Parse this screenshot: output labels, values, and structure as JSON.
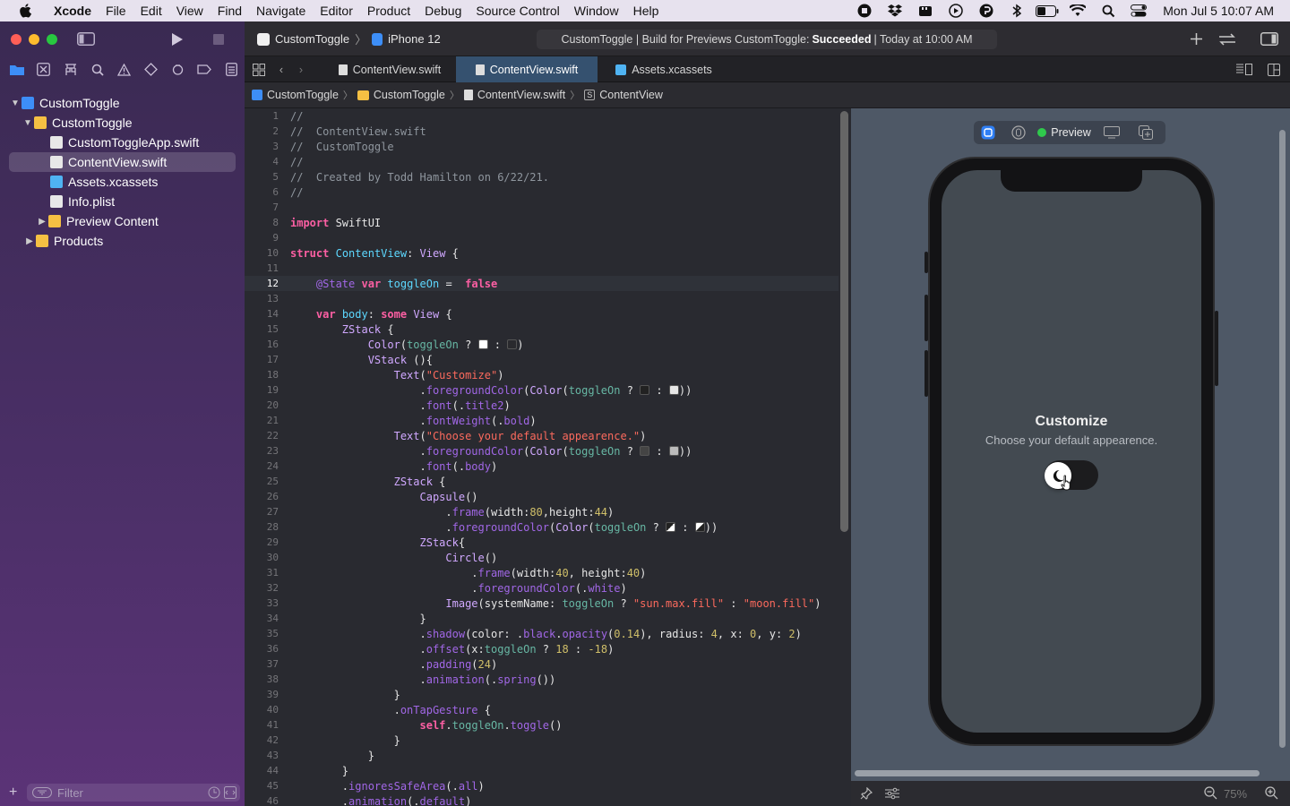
{
  "menubar": {
    "app_name": "Xcode",
    "items": [
      "File",
      "Edit",
      "View",
      "Find",
      "Navigate",
      "Editor",
      "Product",
      "Debug",
      "Source Control",
      "Window",
      "Help"
    ],
    "datetime": "Mon Jul 5  10:07 AM"
  },
  "toolbar": {
    "scheme_project": "CustomToggle",
    "scheme_device": "iPhone 12",
    "status_prefix": "CustomToggle | Build for Previews CustomToggle: ",
    "status_result": "Succeeded",
    "status_suffix": " | Today at 10:00 AM"
  },
  "tabs": [
    {
      "label": "ContentView.swift",
      "active": false
    },
    {
      "label": "ContentView.swift",
      "active": true
    },
    {
      "label": "Assets.xcassets",
      "active": false
    }
  ],
  "jumpbar": [
    "CustomToggle",
    "CustomToggle",
    "ContentView.swift",
    "ContentView"
  ],
  "navigator": {
    "tree": [
      {
        "label": "CustomToggle",
        "level": 0,
        "icon": "project-icon",
        "disclosure": "open"
      },
      {
        "label": "CustomToggle",
        "level": 1,
        "icon": "folder-icon",
        "disclosure": "open"
      },
      {
        "label": "CustomToggleApp.swift",
        "level": 2,
        "icon": "swift-file-icon",
        "disclosure": ""
      },
      {
        "label": "ContentView.swift",
        "level": 2,
        "icon": "swift-file-icon",
        "disclosure": "",
        "selected": true
      },
      {
        "label": "Assets.xcassets",
        "level": 2,
        "icon": "assets-icon",
        "disclosure": ""
      },
      {
        "label": "Info.plist",
        "level": 2,
        "icon": "plist-icon",
        "disclosure": ""
      },
      {
        "label": "Preview Content",
        "level": 2,
        "icon": "folder-icon",
        "disclosure": "closed"
      },
      {
        "label": "Products",
        "level": 1,
        "icon": "folder-icon",
        "disclosure": "closed"
      }
    ],
    "filter_placeholder": "Filter"
  },
  "editor": {
    "current_line": 12,
    "first_line": 1,
    "line_count": 46
  },
  "preview": {
    "label": "Preview",
    "title": "Customize",
    "subtitle": "Choose your default appearence.",
    "zoom": "75%"
  },
  "colors": {
    "accent": "#35516f",
    "sidebar_top": "#3a2a52",
    "sidebar_bottom": "#5b3377",
    "editor_bg": "#292a30",
    "canvas_bg": "#4e5866",
    "keyword": "#fc5fa3",
    "string": "#fc6a5d",
    "comment": "#8f969e",
    "number": "#d0bf69"
  }
}
